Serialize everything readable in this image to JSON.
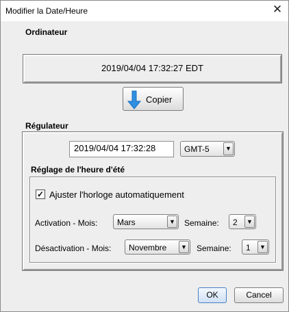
{
  "window": {
    "title": "Modifier la Date/Heure",
    "close_glyph": "✕"
  },
  "ordinateur": {
    "label": "Ordinateur",
    "datetime": "2019/04/04 17:32:27   EDT"
  },
  "copy_button": {
    "label": "Copier",
    "icon": "arrow-down-icon"
  },
  "regulateur": {
    "label": "Régulateur",
    "datetime": "2019/04/04 17:32:28",
    "timezone": "GMT-5"
  },
  "dst": {
    "label": "Réglage de l'heure d'été",
    "auto_checkbox_label": "Ajuster l'horloge automatiquement",
    "auto_checked": true,
    "activation_label": "Activation  -  Mois:",
    "activation_month": "Mars",
    "activation_week_label": "Semaine:",
    "activation_week": "2",
    "deactivation_label": "Désactivation - Mois:",
    "deactivation_month": "Novembre",
    "deactivation_week_label": "Semaine:",
    "deactivation_week": "1"
  },
  "footer": {
    "ok_label": "OK",
    "cancel_label": "Cancel"
  },
  "colors": {
    "dialog_bg": "#eeeeee",
    "ok_border": "#4a7fc1",
    "copy_icon": "#2f8fe0"
  }
}
